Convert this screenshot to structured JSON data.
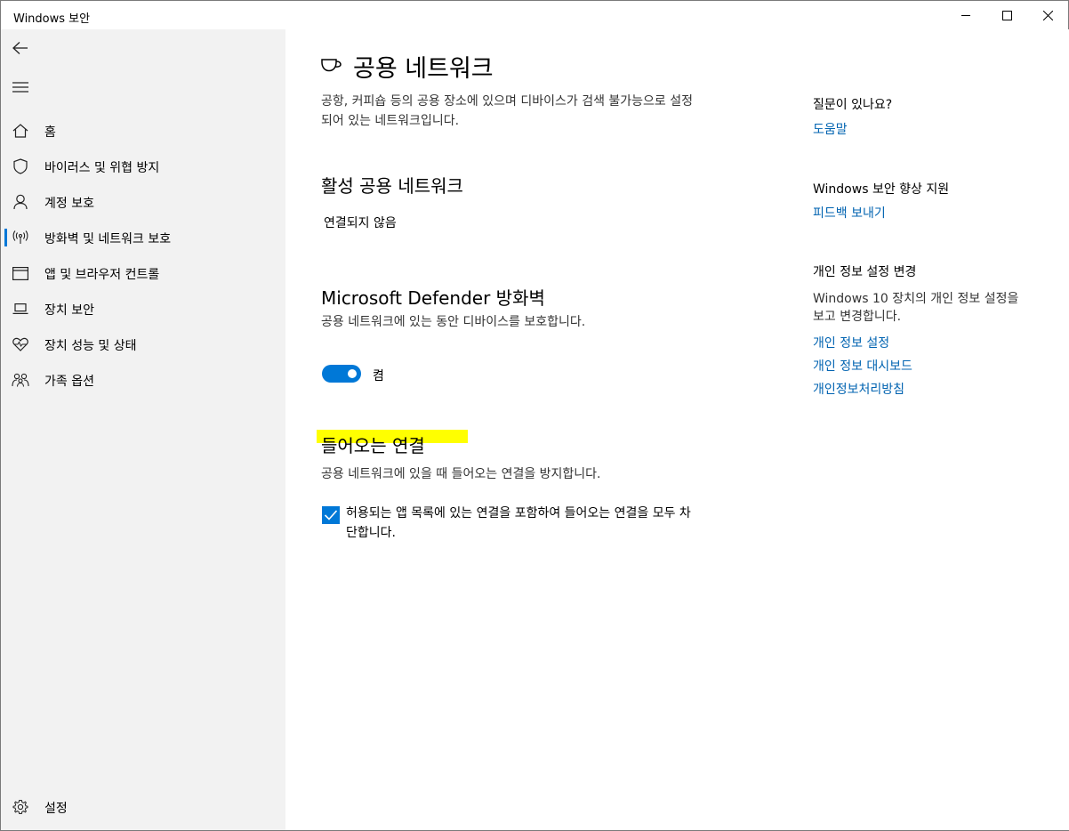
{
  "window": {
    "title": "Windows 보안"
  },
  "sidebar": {
    "items": [
      {
        "label": "홈"
      },
      {
        "label": "바이러스 및 위협 방지"
      },
      {
        "label": "계정 보호"
      },
      {
        "label": "방화벽 및 네트워크 보호"
      },
      {
        "label": "앱 및 브라우저 컨트롤"
      },
      {
        "label": "장치 보안"
      },
      {
        "label": "장치 성능 및 상태"
      },
      {
        "label": "가족 옵션"
      }
    ],
    "active_index": 3,
    "settings_label": "설정"
  },
  "main": {
    "title": "공용 네트워크",
    "description_line1": "공항, 커피숍 등의 공용 장소에 있으며 디바이스가 검색 불가능으로 설정",
    "description_line2": "되어 있는 네트워크입니다.",
    "active_network": {
      "heading": "활성 공용 네트워크",
      "status": "연결되지 않음"
    },
    "firewall": {
      "heading": "Microsoft Defender 방화벽",
      "description": "공용 네트워크에 있는 동안 디바이스를 보호합니다.",
      "toggle_on": true,
      "toggle_label": "켬"
    },
    "incoming": {
      "heading": "들어오는 연결",
      "description": "공용 네트워크에 있을 때 들어오는 연결을 방지합니다.",
      "checkbox_checked": true,
      "checkbox_label_line1": "허용되는 앱 목록에 있는 연결을 포함하여 들어오는 연결을 모두 차",
      "checkbox_label_line2": "단합니다."
    }
  },
  "right_panel": {
    "question_heading": "질문이 있나요?",
    "help_link": "도움말",
    "improve_heading": "Windows 보안 향상 지원",
    "feedback_link": "피드백 보내기",
    "privacy_heading": "개인 정보 설정 변경",
    "privacy_text": "Windows 10 장치의 개인 정보 설정을 보고 변경합니다.",
    "privacy_links": [
      "개인 정보 설정",
      "개인 정보 대시보드",
      "개인정보처리방침"
    ]
  },
  "colors": {
    "accent": "#0078d7",
    "link": "#0063b1",
    "sidebar_bg": "#f2f2f2",
    "highlight": "#ffff00"
  }
}
